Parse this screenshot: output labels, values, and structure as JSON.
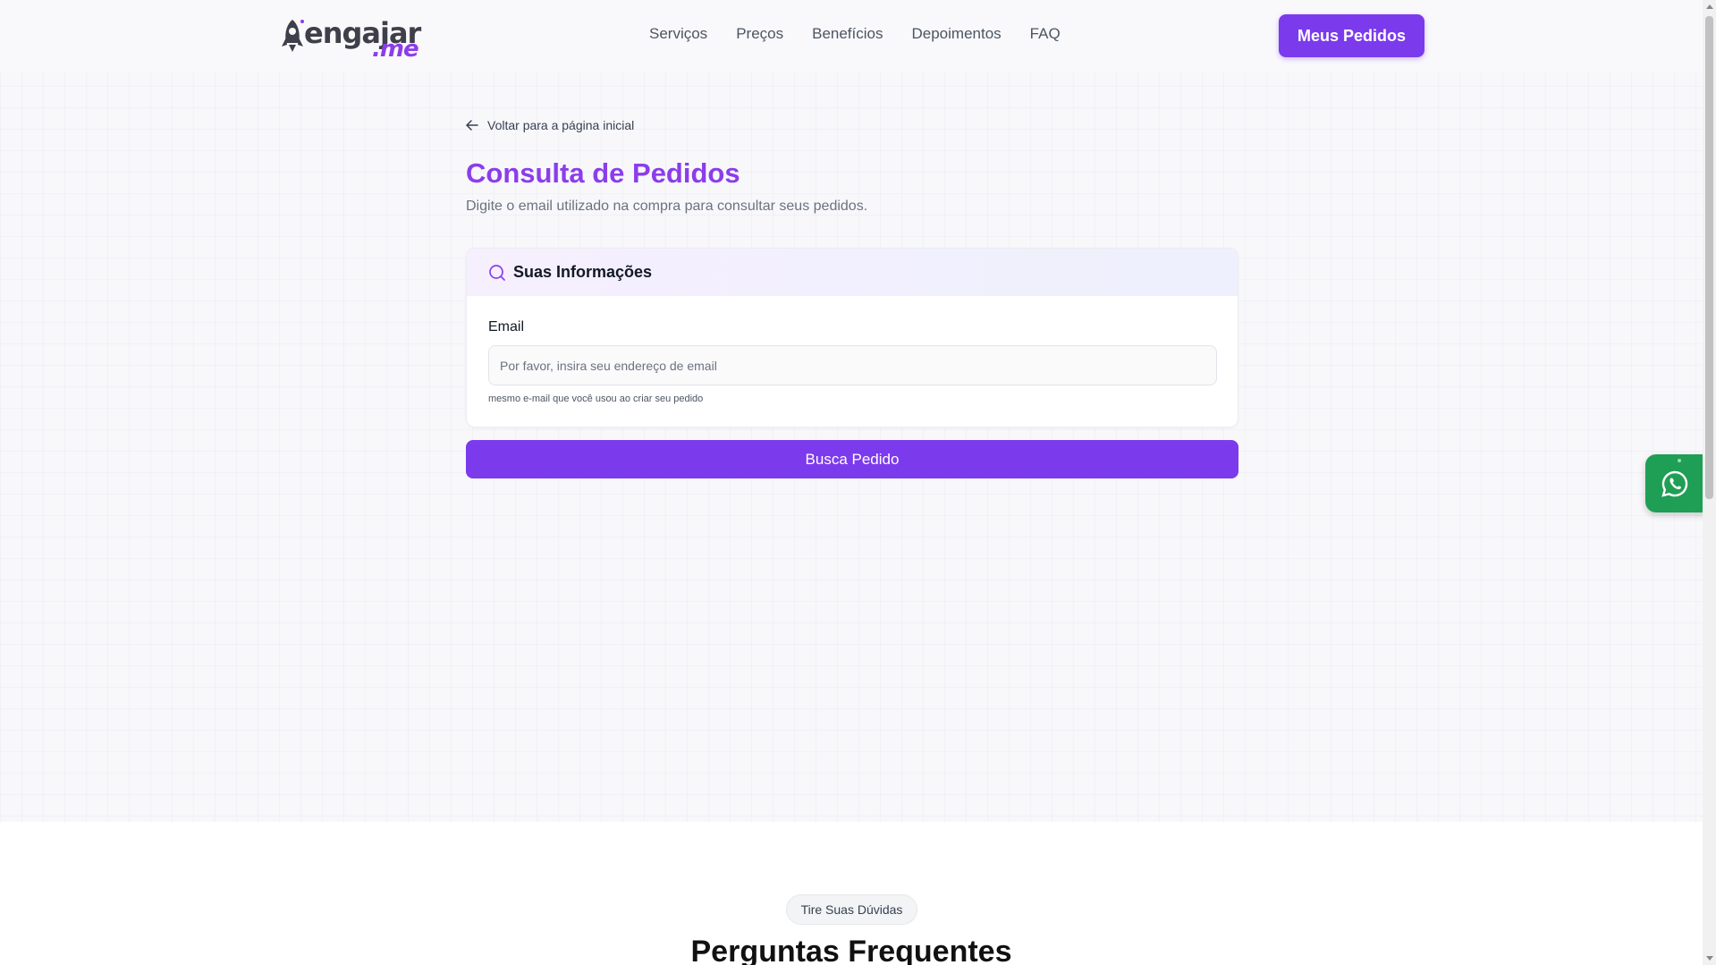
{
  "logo": {
    "text": "engajar",
    "suffix": ".me",
    "brand_color": "#8b3dea"
  },
  "nav": {
    "items": [
      "Serviços",
      "Preços",
      "Benefícios",
      "Depoimentos",
      "FAQ"
    ],
    "cta_label": "Meus Pedidos"
  },
  "back_link": {
    "label": "Voltar para a página inicial"
  },
  "page": {
    "title": "Consulta de Pedidos",
    "subtitle": "Digite o email utilizado na compra para consultar seus pedidos."
  },
  "form": {
    "card_title": "Suas Informações",
    "email_label": "Email",
    "email_value": "",
    "email_placeholder": "Por favor, insira seu endereço de email",
    "email_hint": "mesmo e-mail que você usou ao criar seu pedido",
    "submit_label": "Busca Pedido"
  },
  "faq": {
    "badge": "Tire Suas Dúvidas",
    "title": "Perguntas Frequentes"
  },
  "floating": {
    "icon": "whatsapp-icon",
    "color": "#1f9e55"
  },
  "colors": {
    "accent": "#7c3aed",
    "title": "#8b3dea"
  }
}
